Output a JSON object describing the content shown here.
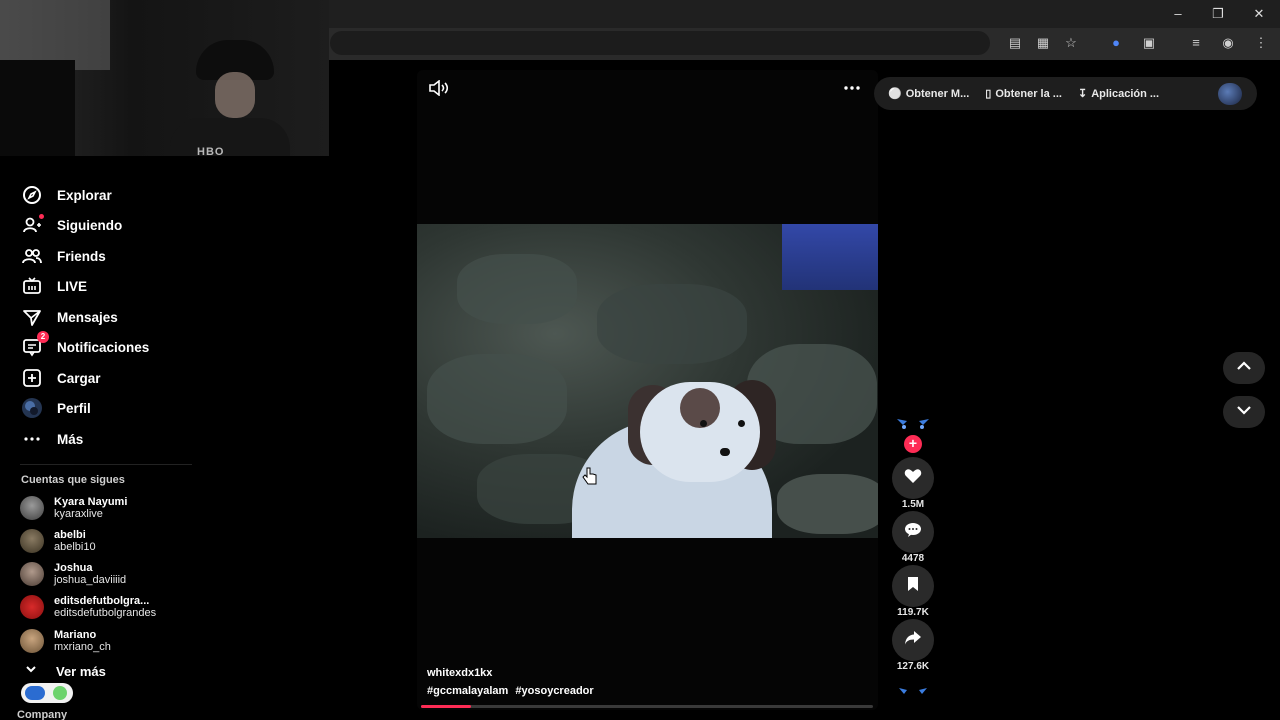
{
  "sidebar": {
    "nav": [
      {
        "label": "Explorar",
        "icon": "compass-icon"
      },
      {
        "label": "Siguiendo",
        "icon": "user-follow-icon"
      },
      {
        "label": "Friends",
        "icon": "friends-icon"
      },
      {
        "label": "LIVE",
        "icon": "live-tv-icon"
      },
      {
        "label": "Mensajes",
        "icon": "paper-plane-icon"
      },
      {
        "label": "Notificaciones",
        "icon": "notification-icon",
        "badge": "2"
      },
      {
        "label": "Cargar",
        "icon": "upload-plus-icon"
      },
      {
        "label": "Perfil",
        "icon": "profile-avatar-icon"
      },
      {
        "label": "Más",
        "icon": "ellipsis-icon"
      }
    ],
    "following_title": "Cuentas que sigues",
    "following": [
      {
        "name": "Kyara Nayumi",
        "username": "kyaraxlive"
      },
      {
        "name": "abelbi",
        "username": "abelbi10"
      },
      {
        "name": "Joshua",
        "username": "joshua_daviiiid"
      },
      {
        "name": "editsdefutbolgra...",
        "username": "editsdefutbolgrandes"
      },
      {
        "name": "Mariano",
        "username": "mxriano_ch"
      }
    ],
    "see_more": "Ver más",
    "company": "Company"
  },
  "video": {
    "username": "whitexdx1kx",
    "hashtags": [
      "#gccmalayalam",
      "#yosoycreador"
    ],
    "progress": 0.11,
    "likes": "1.5M",
    "comments": "4478",
    "saves": "119.7K",
    "shares": "127.6K"
  },
  "extension_bar": {
    "items": [
      "Obtener M...",
      "Obtener la ...",
      "Aplicación ..."
    ]
  },
  "colors": {
    "accent": "#fe2c55",
    "background": "#000000"
  }
}
